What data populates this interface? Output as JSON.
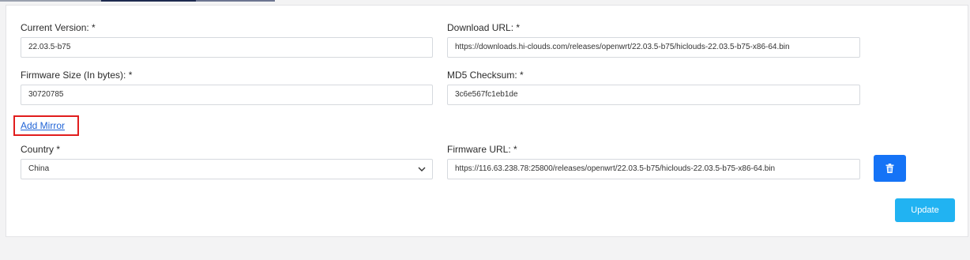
{
  "colors": {
    "tab_light": "#9aa0ae",
    "tab_dark": "#1d2a4f",
    "tab_mid": "#6c7590",
    "link": "#1f63d6",
    "highlight": "#e11d1d",
    "trash_button": "#1573f6",
    "update_button": "#21b3f2"
  },
  "form": {
    "current_version": {
      "label": "Current Version: *",
      "value": "22.03.5-b75"
    },
    "download_url": {
      "label": "Download URL: *",
      "value": "https://downloads.hi-clouds.com/releases/openwrt/22.03.5-b75/hiclouds-22.03.5-b75-x86-64.bin"
    },
    "firmware_size": {
      "label": "Firmware Size (In bytes): *",
      "value": "30720785"
    },
    "md5_checksum": {
      "label": "MD5 Checksum: *",
      "value": "3c6e567fc1eb1de"
    },
    "add_mirror_label": "Add Mirror",
    "country": {
      "label": "Country *",
      "value": "China"
    },
    "firmware_url": {
      "label": "Firmware URL: *",
      "value": "https://116.63.238.78:25800/releases/openwrt/22.03.5-b75/hiclouds-22.03.5-b75-x86-64.bin"
    },
    "delete_icon": "trash-icon",
    "update_label": "Update"
  }
}
